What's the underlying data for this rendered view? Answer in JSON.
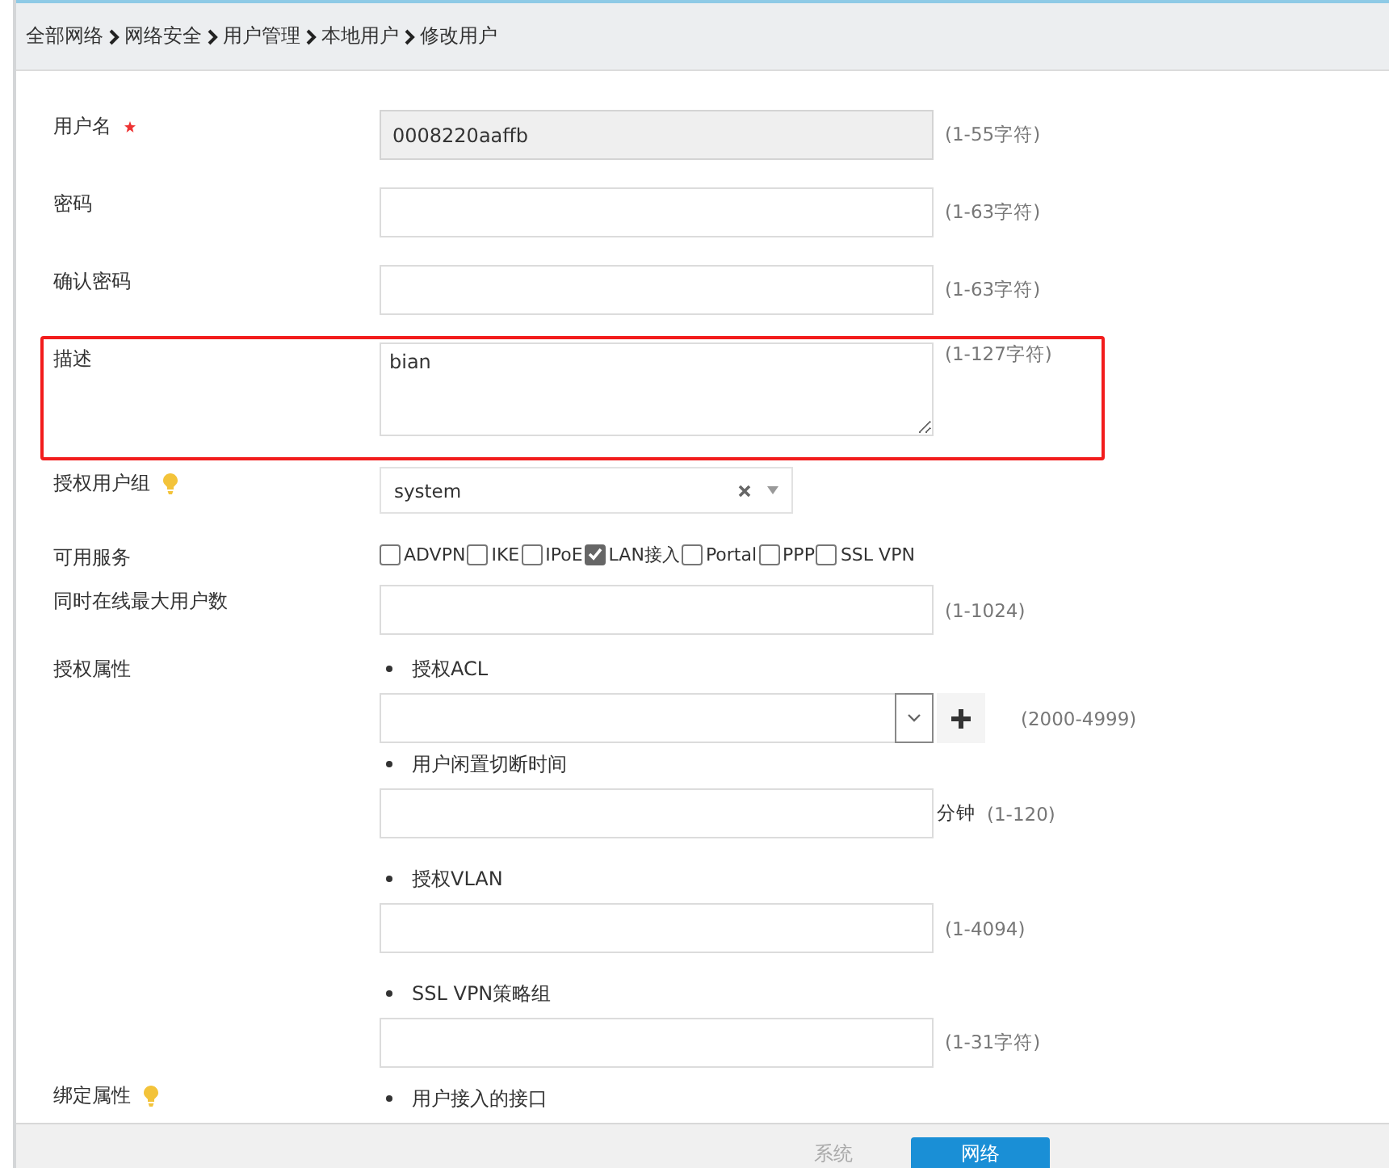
{
  "breadcrumb": [
    "全部网络",
    "网络安全",
    "用户管理",
    "本地用户",
    "修改用户"
  ],
  "fields": [
    {
      "kind": "text",
      "label": "用户名",
      "required": true,
      "tip": false,
      "disabled": true,
      "highlighted": false,
      "value": "0008220aaffb",
      "hint": "(1-55字符)"
    },
    {
      "kind": "text",
      "label": "密码",
      "required": false,
      "tip": false,
      "disabled": false,
      "highlighted": false,
      "hint": "(1-63字符)"
    },
    {
      "kind": "text",
      "label": "确认密码",
      "required": false,
      "tip": false,
      "disabled": false,
      "highlighted": false,
      "hint": "(1-63字符)"
    },
    {
      "kind": "textarea",
      "label": "描述",
      "required": false,
      "tip": false,
      "disabled": false,
      "highlighted": true,
      "value": "bian",
      "hint": "(1-127字符)"
    },
    {
      "kind": "select",
      "label": "授权用户组",
      "required": false,
      "tip": true,
      "highlighted": false,
      "value": "system"
    },
    {
      "kind": "checkboxes",
      "label": "可用服务",
      "required": false,
      "tip": false,
      "highlighted": false,
      "options": [
        {
          "label": "ADVPN",
          "checked": false
        },
        {
          "label": "IKE",
          "checked": false
        },
        {
          "label": "IPoE",
          "checked": false
        },
        {
          "label": "LAN接入",
          "checked": true
        },
        {
          "label": "Portal",
          "checked": false
        },
        {
          "label": "PPP",
          "checked": false
        },
        {
          "label": "SSL VPN",
          "checked": false
        }
      ]
    },
    {
      "kind": "text",
      "label": "同时在线最大用户数",
      "required": false,
      "tip": false,
      "disabled": false,
      "highlighted": false,
      "hint": "(1-1024)"
    },
    {
      "kind": "group",
      "label": "授权属性",
      "required": false,
      "tip": false,
      "highlighted": false,
      "items": [
        {
          "kind": "combo",
          "label": "授权ACL",
          "hint": "(2000-4999)"
        },
        {
          "kind": "text",
          "label": "用户闲置切断时间",
          "unit": "分钟",
          "hint": "(1-120)"
        },
        {
          "kind": "text",
          "label": "授权VLAN",
          "hint": "(1-4094)"
        },
        {
          "kind": "text",
          "label": "SSL VPN策略组",
          "hint": "(1-31字符)"
        }
      ]
    },
    {
      "kind": "group",
      "label": "绑定属性",
      "required": false,
      "tip": true,
      "highlighted": false,
      "items": [
        {
          "kind": "bullet",
          "label": "用户接入的接口"
        }
      ]
    }
  ],
  "footer_buttons": [
    {
      "label": "系统",
      "primary": false
    },
    {
      "label": "网络",
      "primary": true
    }
  ]
}
